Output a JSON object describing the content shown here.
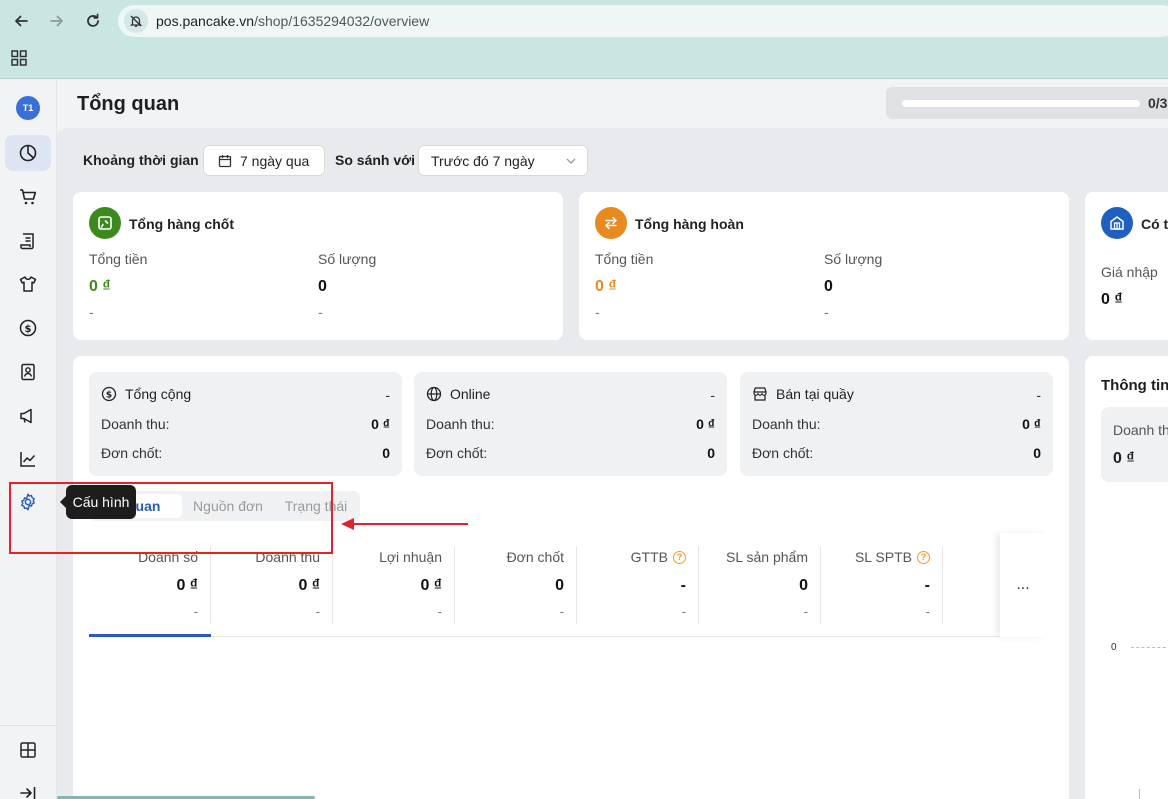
{
  "browser": {
    "url_host": "pos.pancake.vn",
    "url_path": "/shop/1635294032/overview"
  },
  "sidebar": {
    "avatar": "T1",
    "tooltip": "Cấu hình"
  },
  "page": {
    "title": "Tổng quan",
    "progress_text": "0/3",
    "progress_fraction": 0
  },
  "filters": {
    "period_label": "Khoảng thời gian",
    "period_value": "7 ngày qua",
    "compare_label": "So sánh với",
    "compare_value": "Trước đó 7 ngày"
  },
  "summary_cards": [
    {
      "title": "Tổng hàng chốt",
      "total_label": "Tổng tiền",
      "total_value": "0 ₫",
      "total_sub": "-",
      "qty_label": "Số lượng",
      "qty_value": "0",
      "qty_sub": "-",
      "accent": "#3c8a1e"
    },
    {
      "title": "Tổng hàng hoàn",
      "total_label": "Tổng tiền",
      "total_value": "0 ₫",
      "total_sub": "-",
      "qty_label": "Số lượng",
      "qty_value": "0",
      "qty_sub": "-",
      "accent": "#e88a1f"
    },
    {
      "title": "Có t",
      "price_label": "Giá nhập",
      "price_value": "0 ₫",
      "accent": "#1f5fbf"
    }
  ],
  "channels": [
    {
      "title": "Tổng cộng",
      "dash": "-",
      "rev_label": "Doanh thu:",
      "rev_value": "0 ₫",
      "ord_label": "Đơn chốt:",
      "ord_value": "0",
      "icon": "dollar-circle-icon"
    },
    {
      "title": "Online",
      "dash": "-",
      "rev_label": "Doanh thu:",
      "rev_value": "0 ₫",
      "ord_label": "Đơn chốt:",
      "ord_value": "0",
      "icon": "globe-icon"
    },
    {
      "title": "Bán tại quầy",
      "dash": "-",
      "rev_label": "Doanh thu:",
      "rev_value": "0 ₫",
      "ord_label": "Đơn chốt:",
      "ord_value": "0",
      "icon": "store-icon"
    }
  ],
  "tabs": [
    "Tổng quan",
    "Nguồn đơn",
    "Trạng thái"
  ],
  "tab_visible_active_text": "g quan",
  "metrics": [
    {
      "label": "Doanh số",
      "value": "0 ₫",
      "sub": "-",
      "help": false
    },
    {
      "label": "Doanh thu",
      "value": "0 ₫",
      "sub": "-",
      "help": false
    },
    {
      "label": "Lợi nhuận",
      "value": "0 ₫",
      "sub": "-",
      "help": false
    },
    {
      "label": "Đơn chốt",
      "value": "0",
      "sub": "-",
      "help": false
    },
    {
      "label": "GTTB",
      "value": "-",
      "sub": "-",
      "help": true
    },
    {
      "label": "SL sản phẩm",
      "value": "0",
      "sub": "-",
      "help": false
    },
    {
      "label": "SL SPTB",
      "value": "-",
      "sub": "-",
      "help": true
    }
  ],
  "more_label": "...",
  "right_panel": {
    "title": "Thông tin",
    "label": "Doanh th",
    "value": "0 ₫",
    "axis_zero": "0"
  }
}
